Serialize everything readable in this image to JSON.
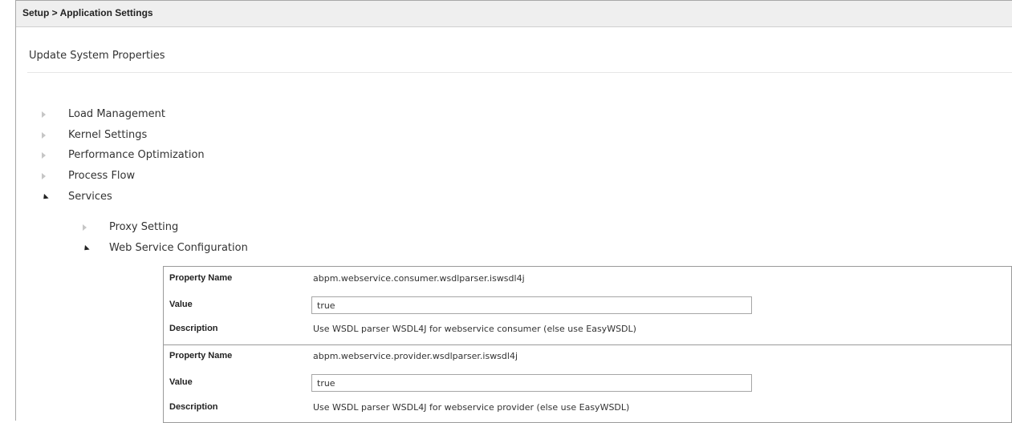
{
  "header": {
    "breadcrumb": "Setup > Application Settings"
  },
  "page": {
    "title": "Update System Properties"
  },
  "tree": {
    "top_items": [
      {
        "label": "Load Management",
        "state": "collapsed"
      },
      {
        "label": "Kernel Settings",
        "state": "collapsed"
      },
      {
        "label": "Performance Optimization",
        "state": "collapsed"
      },
      {
        "label": "Process Flow",
        "state": "collapsed"
      },
      {
        "label": "Services",
        "state": "expanded"
      }
    ],
    "sub_items": [
      {
        "label": "Proxy Setting",
        "state": "collapsed"
      },
      {
        "label": "Web Service Configuration",
        "state": "expanded"
      }
    ]
  },
  "labels": {
    "property_name": "Property Name",
    "value": "Value",
    "description": "Description"
  },
  "properties": [
    {
      "name": "abpm.webservice.consumer.wsdlparser.iswsdl4j",
      "value": "true",
      "description": "Use WSDL parser WSDL4J for webservice consumer (else use EasyWSDL)"
    },
    {
      "name": "abpm.webservice.provider.wsdlparser.iswsdl4j",
      "value": "true",
      "description": "Use WSDL parser WSDL4J for webservice provider (else use EasyWSDL)"
    }
  ],
  "icons": {
    "collapsed": "triangle-right-icon",
    "expanded": "triangle-down-icon"
  }
}
